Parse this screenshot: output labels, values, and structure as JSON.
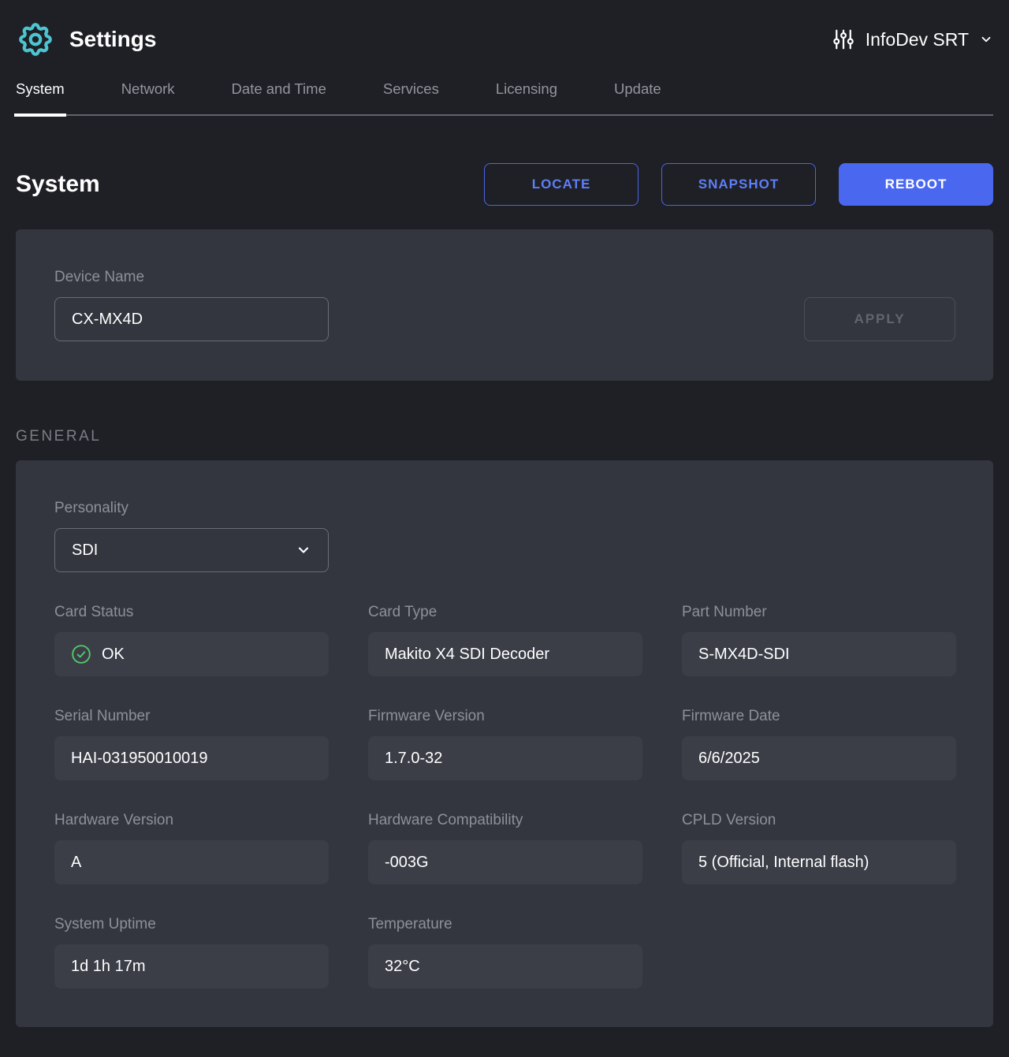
{
  "colors": {
    "accent_blue": "#4a67f0",
    "outline_blue_text": "#5f7efa",
    "brand_teal": "#4cc5d2",
    "status_ok_green": "#55c46a",
    "page_bg": "#1e2025",
    "card_bg": "#33363e",
    "value_box_bg": "#3b3e47"
  },
  "header": {
    "title": "Settings",
    "device_selector_label": "InfoDev SRT"
  },
  "tabs": [
    {
      "label": "System",
      "active": true
    },
    {
      "label": "Network",
      "active": false
    },
    {
      "label": "Date and Time",
      "active": false
    },
    {
      "label": "Services",
      "active": false
    },
    {
      "label": "Licensing",
      "active": false
    },
    {
      "label": "Update",
      "active": false
    }
  ],
  "page": {
    "title": "System",
    "actions": {
      "locate": "LOCATE",
      "snapshot": "SNAPSHOT",
      "reboot": "REBOOT"
    }
  },
  "device_name_card": {
    "label": "Device Name",
    "value": "CX-MX4D",
    "apply_label": "APPLY"
  },
  "general_section": {
    "heading": "GENERAL",
    "personality": {
      "label": "Personality",
      "value": "SDI"
    },
    "fields": [
      {
        "label": "Card Status",
        "value": "OK",
        "status": "ok"
      },
      {
        "label": "Card Type",
        "value": "Makito X4 SDI Decoder"
      },
      {
        "label": "Part Number",
        "value": "S-MX4D-SDI"
      },
      {
        "label": "Serial Number",
        "value": "HAI-031950010019"
      },
      {
        "label": "Firmware Version",
        "value": "1.7.0-32"
      },
      {
        "label": "Firmware Date",
        "value": "6/6/2025"
      },
      {
        "label": "Hardware Version",
        "value": "A"
      },
      {
        "label": "Hardware Compatibility",
        "value": "-003G"
      },
      {
        "label": "CPLD Version",
        "value": "5 (Official, Internal flash)"
      },
      {
        "label": "System Uptime",
        "value": "1d 1h 17m"
      },
      {
        "label": "Temperature",
        "value": "32°C"
      }
    ]
  }
}
